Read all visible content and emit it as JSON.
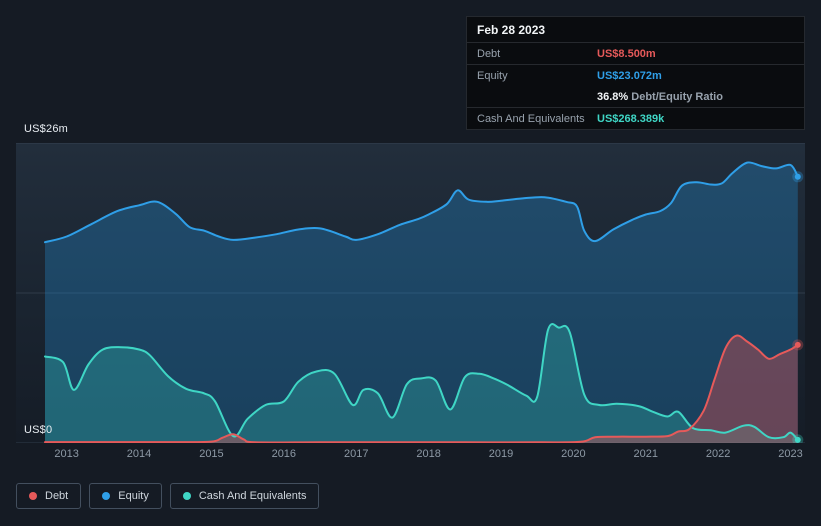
{
  "colors": {
    "debt": "#e65a5a",
    "equity": "#2f9fe8",
    "cash": "#3fd6c5",
    "background": "#151b24"
  },
  "axis": {
    "y_top_label": "US$26m",
    "y_bottom_label": "US$0"
  },
  "tooltip": {
    "date": "Feb 28 2023",
    "debt_label": "Debt",
    "debt_value": "US$8.500m",
    "equity_label": "Equity",
    "equity_value": "US$23.072m",
    "ratio_value": "36.8%",
    "ratio_label": "Debt/Equity Ratio",
    "cash_label": "Cash And Equivalents",
    "cash_value": "US$268.389k"
  },
  "legend": {
    "items": [
      {
        "label": "Debt",
        "color": "#e65a5a"
      },
      {
        "label": "Equity",
        "color": "#2f9fe8"
      },
      {
        "label": "Cash And Equivalents",
        "color": "#3fd6c5"
      }
    ]
  },
  "chart_data": {
    "type": "area",
    "title": "",
    "xlim": [
      2012.3,
      2023.2
    ],
    "ylim": [
      0,
      26
    ],
    "y_gridlines": [
      0,
      13,
      26
    ],
    "x_ticks": [
      2013,
      2014,
      2015,
      2016,
      2017,
      2018,
      2019,
      2020,
      2021,
      2022,
      2023
    ],
    "y_label_top": "US$26m",
    "y_label_bottom": "US$0",
    "legend_position": "bottom-left",
    "series": [
      {
        "name": "Equity",
        "color": "#2f9fe8",
        "fill": "rgba(36,148,223,0.30)",
        "x": [
          2012.7,
          2013.0,
          2013.35,
          2013.7,
          2014.0,
          2014.25,
          2014.5,
          2014.7,
          2014.9,
          2015.1,
          2015.3,
          2015.6,
          2015.9,
          2016.2,
          2016.5,
          2016.85,
          2017.0,
          2017.3,
          2017.6,
          2017.85,
          2018.0,
          2018.25,
          2018.4,
          2018.55,
          2018.8,
          2019.0,
          2019.3,
          2019.6,
          2019.9,
          2020.05,
          2020.15,
          2020.3,
          2020.55,
          2020.8,
          2021.0,
          2021.2,
          2021.35,
          2021.5,
          2021.7,
          2021.9,
          2022.05,
          2022.2,
          2022.4,
          2022.6,
          2022.8,
          2023.0,
          2023.1
        ],
        "values": [
          17.4,
          17.9,
          19.0,
          20.1,
          20.6,
          20.9,
          19.9,
          18.7,
          18.4,
          17.9,
          17.6,
          17.8,
          18.1,
          18.5,
          18.6,
          17.9,
          17.6,
          18.1,
          18.9,
          19.4,
          19.8,
          20.7,
          21.9,
          21.1,
          20.9,
          21.0,
          21.2,
          21.3,
          20.9,
          20.5,
          18.4,
          17.5,
          18.5,
          19.3,
          19.8,
          20.1,
          20.8,
          22.3,
          22.6,
          22.4,
          22.5,
          23.4,
          24.3,
          24.0,
          23.8,
          24.1,
          23.1
        ]
      },
      {
        "name": "Cash And Equivalents",
        "color": "#3fd6c5",
        "fill": "rgba(54,200,184,0.28)",
        "x": [
          2012.7,
          2012.95,
          2013.1,
          2013.3,
          2013.5,
          2013.75,
          2014.0,
          2014.15,
          2014.4,
          2014.65,
          2014.9,
          2015.05,
          2015.3,
          2015.5,
          2015.75,
          2016.0,
          2016.2,
          2016.45,
          2016.7,
          2016.95,
          2017.1,
          2017.3,
          2017.5,
          2017.7,
          2017.9,
          2018.1,
          2018.3,
          2018.5,
          2018.7,
          2018.9,
          2019.1,
          2019.35,
          2019.5,
          2019.65,
          2019.8,
          2019.95,
          2020.15,
          2020.35,
          2020.6,
          2020.9,
          2021.1,
          2021.3,
          2021.45,
          2021.65,
          2021.9,
          2022.1,
          2022.35,
          2022.5,
          2022.7,
          2022.9,
          2023.0,
          2023.1
        ],
        "values": [
          7.5,
          7.0,
          4.6,
          6.8,
          8.1,
          8.3,
          8.1,
          7.6,
          5.8,
          4.7,
          4.3,
          3.6,
          0.6,
          2.1,
          3.3,
          3.6,
          5.3,
          6.2,
          6.0,
          3.3,
          4.6,
          4.3,
          2.2,
          5.1,
          5.6,
          5.4,
          2.9,
          5.7,
          6.0,
          5.6,
          5.0,
          4.1,
          4.0,
          9.8,
          10.0,
          9.6,
          4.2,
          3.3,
          3.4,
          3.2,
          2.7,
          2.3,
          2.7,
          1.3,
          1.1,
          0.9,
          1.5,
          1.4,
          0.5,
          0.5,
          0.9,
          0.27
        ]
      },
      {
        "name": "Debt",
        "color": "#e65a5a",
        "fill": "rgba(229,78,78,0.38)",
        "x": [
          2012.7,
          2013.5,
          2014.5,
          2015.0,
          2015.15,
          2015.3,
          2015.45,
          2015.6,
          2016.5,
          2017.5,
          2018.5,
          2019.5,
          2020.1,
          2020.3,
          2020.6,
          2021.0,
          2021.3,
          2021.45,
          2021.6,
          2021.8,
          2021.95,
          2022.1,
          2022.25,
          2022.4,
          2022.55,
          2022.7,
          2022.85,
          2023.0,
          2023.1
        ],
        "values": [
          0.08,
          0.08,
          0.08,
          0.12,
          0.45,
          0.75,
          0.3,
          0.06,
          0.06,
          0.06,
          0.06,
          0.06,
          0.1,
          0.5,
          0.55,
          0.55,
          0.6,
          1.0,
          1.2,
          2.8,
          5.5,
          8.2,
          9.3,
          8.8,
          8.1,
          7.3,
          7.7,
          8.1,
          8.5
        ]
      }
    ],
    "end_markers": [
      {
        "series": "Equity",
        "x": 2023.1,
        "value": 23.072
      },
      {
        "series": "Debt",
        "x": 2023.1,
        "value": 8.5
      },
      {
        "series": "Cash And Equivalents",
        "x": 2023.1,
        "value": 0.268
      }
    ]
  }
}
